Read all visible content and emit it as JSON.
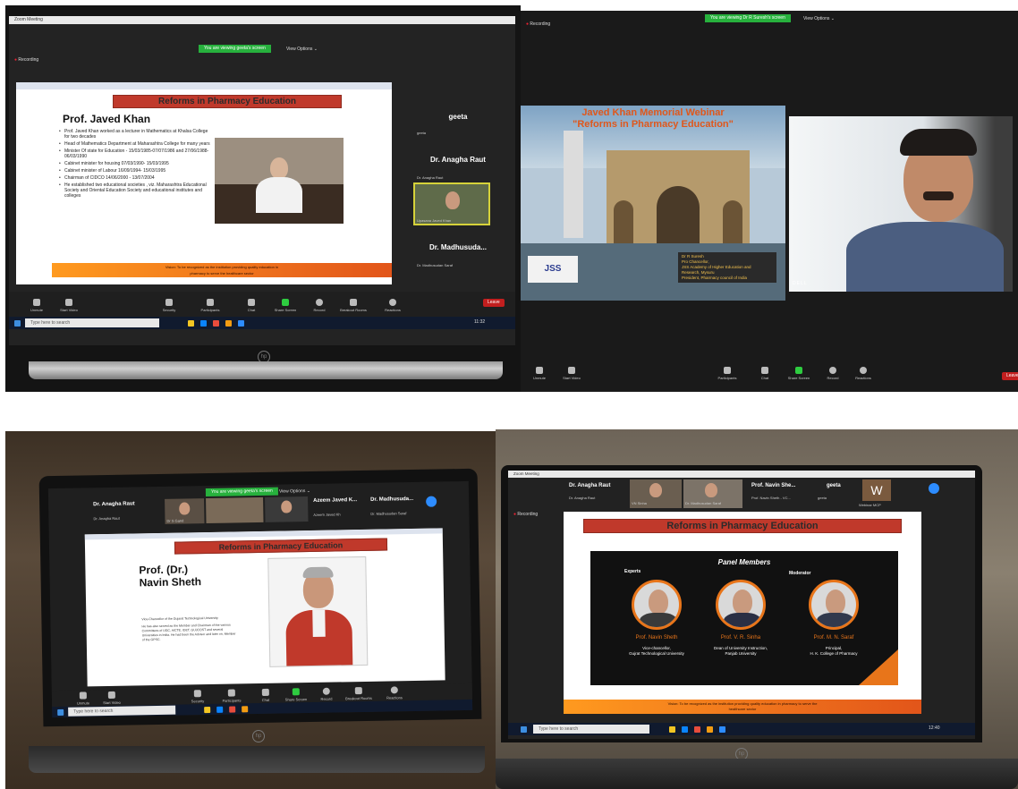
{
  "photo1": {
    "window_title": "Zoom Meeting",
    "banner": "You are viewing geeta's screen",
    "view_options": "View Options ⌄",
    "recording": "Recording",
    "slide": {
      "title": "Reforms in Pharmacy Education",
      "name": "Prof. Javed Khan",
      "bullets": [
        "Prof. Javed Khan worked as a lecturer in Mathematics at Khalsa College for two decades",
        "Head of Mathematics Department at Maharashtra College for many years",
        "Minister Of state for Education - 15/03/1985-07/07/1986 and 27/06/1988-06/03/1990",
        "Cabinet minister for housing 07/03/1990- 15/03/1995",
        "Cabinet minister of Labour 16/09/1994- 15/03/1995",
        "Chairman of CIDCO 14/06/2000 - 13/07/2004",
        "He established two educational societies , viz. Maharashtra Educational Society and Oriental Education Society and educational institutes and colleges"
      ],
      "footer": "Vision: To be recognized as the institution providing quality education in pharmacy to serve the healthcare sector"
    },
    "participants": [
      {
        "name": "geeta",
        "sub": "geeta"
      },
      {
        "name": "Dr. Anagha Raut",
        "sub": "Dr. Anagha Raut"
      },
      {
        "name": "",
        "sub": "Upasana Javed Khan"
      },
      {
        "name": "Dr. Madhusuda...",
        "sub": "Dr. Madhusudan Saraf"
      }
    ],
    "controls": [
      "Unmute",
      "Start Video",
      "Security",
      "Participants",
      "Chat",
      "Share Screen",
      "Record",
      "Breakout Rooms",
      "Reactions"
    ],
    "participant_count": "3",
    "leave": "Leave",
    "taskbar_search": "Type here to search",
    "clock": "11:32"
  },
  "photo2": {
    "banner": "You are viewing Dr R Suresh's screen",
    "view_options": "View Options ⌄",
    "recording": "Recording",
    "slide_title_line1": "Javed Khan Memorial Webinar",
    "slide_title_line2": "\"Reforms in Pharmacy Education\"",
    "speaker_card": [
      "Dr R Suresh",
      "Pro Chancellor,",
      "JSS Academy of Higher Education and",
      "Research, Mysuru",
      "President, Pharmacy council of India"
    ],
    "logo_text": "JSS",
    "video_label": "DELL",
    "controls": [
      "Unmute",
      "Start Video",
      "Participants",
      "Chat",
      "Share Screen",
      "Record",
      "Reactions"
    ],
    "participant_count": "66",
    "leave": "Leave"
  },
  "photo3": {
    "banner": "You are viewing geeta's screen",
    "view_options": "View Options ⌄",
    "participants": [
      "Dr. Anagha Raut",
      "",
      "",
      "Azeem Javed K...",
      "Dr. Madhusuda..."
    ],
    "participant_subs": [
      "Dr. Anagha Raut",
      "Dr S Gand",
      "",
      "Azeem Javed Kh",
      "Dr. Madhusudan Saraf"
    ],
    "slide": {
      "title": "Reforms in Pharmacy Education",
      "name_line1": "Prof. (Dr.)",
      "name_line2": "Navin Sheth",
      "bio": [
        "Vice-Chancellor of the Gujarat Technological University.",
        "He has also served as the Member and Chairman of the various Committees of UGC, AICTE, IDET, GUJCOST and several Universities in India. He had been the Advisor and later on, Member of the GPSC."
      ]
    },
    "controls": [
      "Unmute",
      "Start Video",
      "Security",
      "Participants",
      "Chat",
      "Share Screen",
      "Record",
      "Breakout Rooms",
      "Reactions"
    ],
    "participant_count": "49",
    "taskbar_search": "Type here to search"
  },
  "photo4": {
    "window_title": "Zoom Meeting",
    "recording": "Recording",
    "top_names": [
      "Dr. Anagha Raut",
      "",
      "",
      "Prof. Navin She...",
      "geeta",
      "W"
    ],
    "top_subs": [
      "Dr. Anagha Raut",
      "VN Sinha",
      "Dr. Madhusudan Saraf",
      "Prof. Navin Sheth - VC...",
      "geeta",
      "Webinar MCP"
    ],
    "slide": {
      "title": "Reforms in Pharmacy Education",
      "panel_title": "Panel Members",
      "experts_label": "Experts",
      "moderator_label": "Moderator",
      "members": [
        {
          "name": "Prof. Navin Sheth",
          "line1": "Vice-chancellor,",
          "line2": "Gujrat Technological University"
        },
        {
          "name": "Prof. V. R. Sinha",
          "line1": "Dean of University Instruction,",
          "line2": "Panjab University"
        },
        {
          "name": "Prof. M. N. Saraf",
          "line1": "Principal,",
          "line2": "H. K. College of Pharmacy"
        }
      ],
      "footer": "Vision: To be recognized as the institution providing quality education in pharmacy to serve the healthcare sector"
    },
    "taskbar_search": "Type here to search",
    "clock": "12:40"
  },
  "colors": {
    "zoom_green": "#27b13d",
    "slide_red": "#c0392b",
    "accent_orange": "#e8751a",
    "leave_red": "#c21f1f"
  }
}
